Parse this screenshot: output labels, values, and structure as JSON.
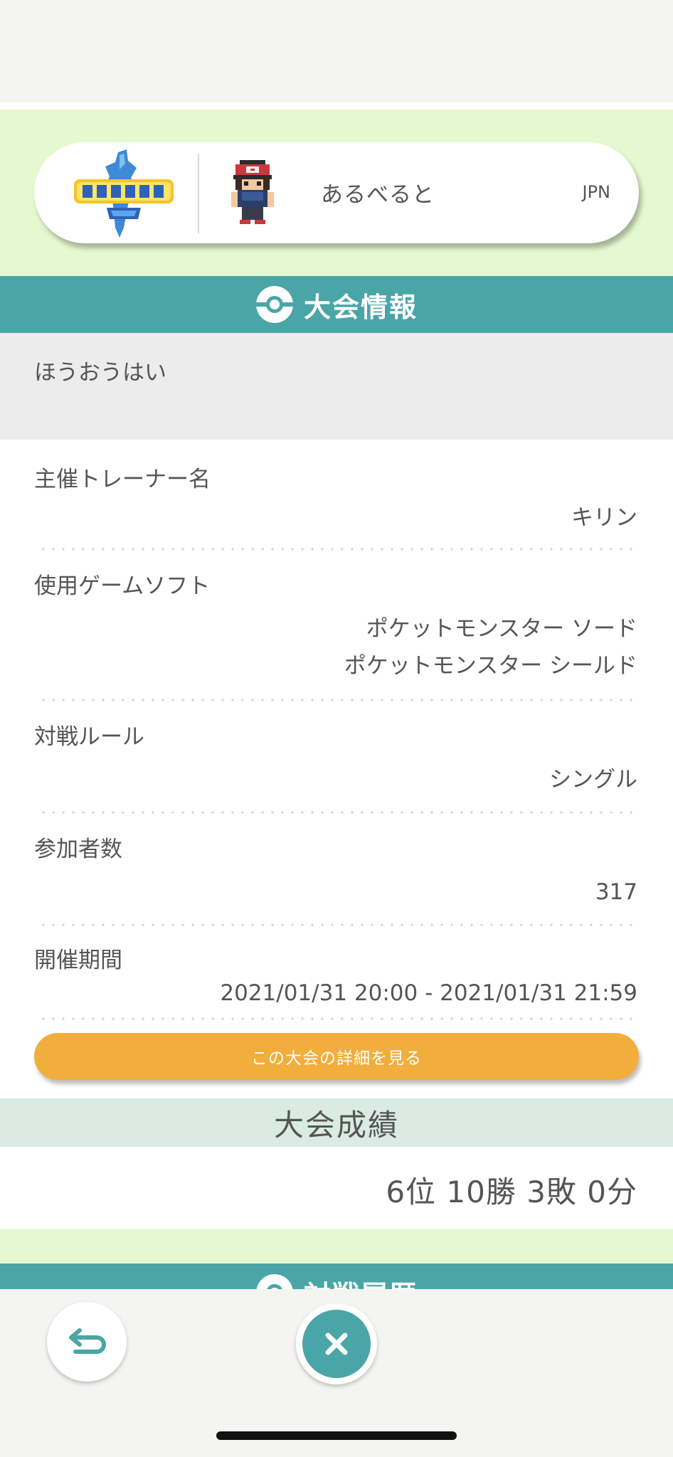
{
  "profile": {
    "game_logo_text": "ポケットモンスター ソード",
    "trainer_name": "あるべると",
    "region": "JPN"
  },
  "tournament_section": {
    "title": "大会情報",
    "name": "ほうおうはい"
  },
  "info": {
    "organizer": {
      "label": "主催トレーナー名",
      "value": "キリン"
    },
    "software": {
      "label": "使用ゲームソフト",
      "values": [
        "ポケットモンスター ソード",
        "ポケットモンスター シールド"
      ]
    },
    "rule": {
      "label": "対戦ルール",
      "value": "シングル"
    },
    "participants": {
      "label": "参加者数",
      "value": "317"
    },
    "period": {
      "label": "開催期間",
      "value": "2021/01/31 20:00 - 2021/01/31 21:59"
    }
  },
  "detail_button": "この大会の詳細を見る",
  "results": {
    "title": "大会成績",
    "value": "6位 10勝 3敗 0分"
  },
  "battle_history": {
    "title": "対戦履歴"
  },
  "colors": {
    "teal": "#4aa5a7",
    "light_green": "#e5f9d0",
    "orange": "#f2ae3c",
    "result_header": "#d9ebe2"
  },
  "icons": {
    "back": "back-arrow-icon",
    "close": "close-icon",
    "section": "poke-ball-icon"
  }
}
